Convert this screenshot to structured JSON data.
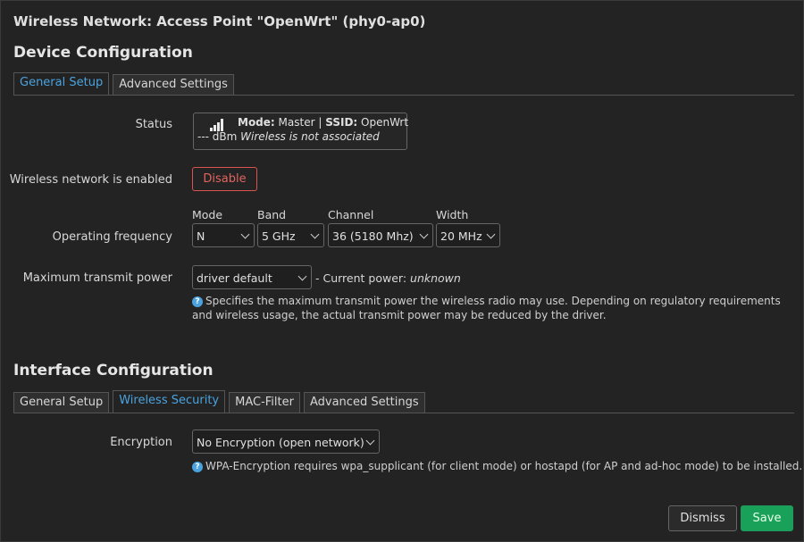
{
  "window": {
    "title": "Wireless Network: Access Point \"OpenWrt\" (phy0-ap0)"
  },
  "device": {
    "heading": "Device Configuration",
    "tabs": [
      "General Setup",
      "Advanced Settings"
    ],
    "status": {
      "label": "Status",
      "mode_key": "Mode:",
      "mode_val": "Master",
      "sep": "|",
      "ssid_key": "SSID:",
      "ssid_val": "OpenWrt",
      "dbm": "--- dBm",
      "assoc": "Wireless is not associated"
    },
    "enabled": {
      "label": "Wireless network is enabled",
      "button": "Disable"
    },
    "frequency": {
      "label": "Operating frequency",
      "mode_label": "Mode",
      "mode_val": "N",
      "band_label": "Band",
      "band_val": "5 GHz",
      "channel_label": "Channel",
      "channel_val": "36 (5180 Mhz)",
      "width_label": "Width",
      "width_val": "20 MHz"
    },
    "txpower": {
      "label": "Maximum transmit power",
      "value": "driver default",
      "current_prefix": "- Current power:",
      "current_val": "unknown",
      "help": "Specifies the maximum transmit power the wireless radio may use. Depending on regulatory requirements and wireless usage, the actual transmit power may be reduced by the driver."
    }
  },
  "interface": {
    "heading": "Interface Configuration",
    "tabs": [
      "General Setup",
      "Wireless Security",
      "MAC-Filter",
      "Advanced Settings"
    ],
    "encryption": {
      "label": "Encryption",
      "value": "No Encryption (open network)",
      "help": "WPA-Encryption requires wpa_supplicant (for client mode) or hostapd (for AP and ad-hoc mode) to be installed."
    }
  },
  "footer": {
    "dismiss": "Dismiss",
    "save": "Save"
  },
  "colors": {
    "accent": "#4aa3df",
    "danger": "#d9534f",
    "save": "#19a15a"
  },
  "icons": [
    "signal-icon",
    "help-icon",
    "chevron-down-icon"
  ]
}
